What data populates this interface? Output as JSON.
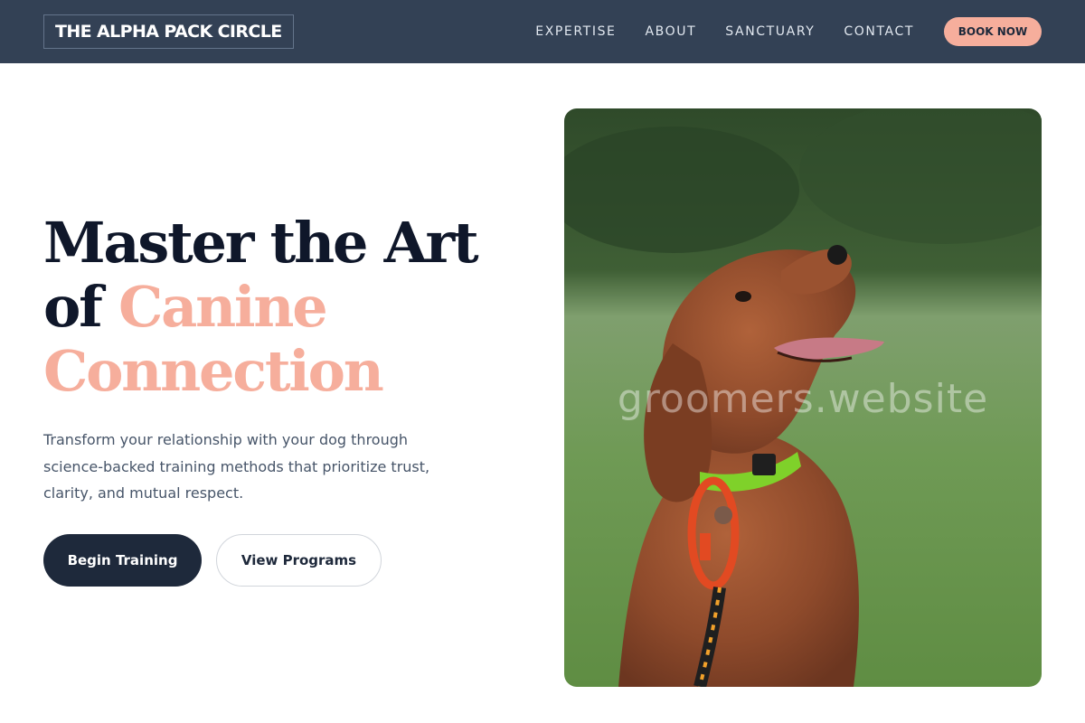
{
  "header": {
    "brand": "THE ALPHA PACK CIRCLE",
    "nav": [
      {
        "label": "EXPERTISE"
      },
      {
        "label": "ABOUT"
      },
      {
        "label": "SANCTUARY"
      },
      {
        "label": "CONTACT"
      }
    ],
    "book_label": "BOOK NOW"
  },
  "hero": {
    "headline_line1": "Master the Art",
    "headline_line2_prefix": "of",
    "headline_accent_1": "Canine",
    "headline_accent_2": "Connection",
    "subtext": "Transform your relationship with your dog through science-backed training methods that prioritize trust, clarity, and mutual respect.",
    "primary_cta": "Begin Training",
    "secondary_cta": "View Programs",
    "image_watermark": "groomers.website"
  },
  "colors": {
    "nav_bg": "#334155",
    "accent": "#f6ae9c",
    "dark": "#1e293b",
    "heading": "#0f172a"
  },
  "icons": {
    "hero_image": "dog-photo"
  }
}
